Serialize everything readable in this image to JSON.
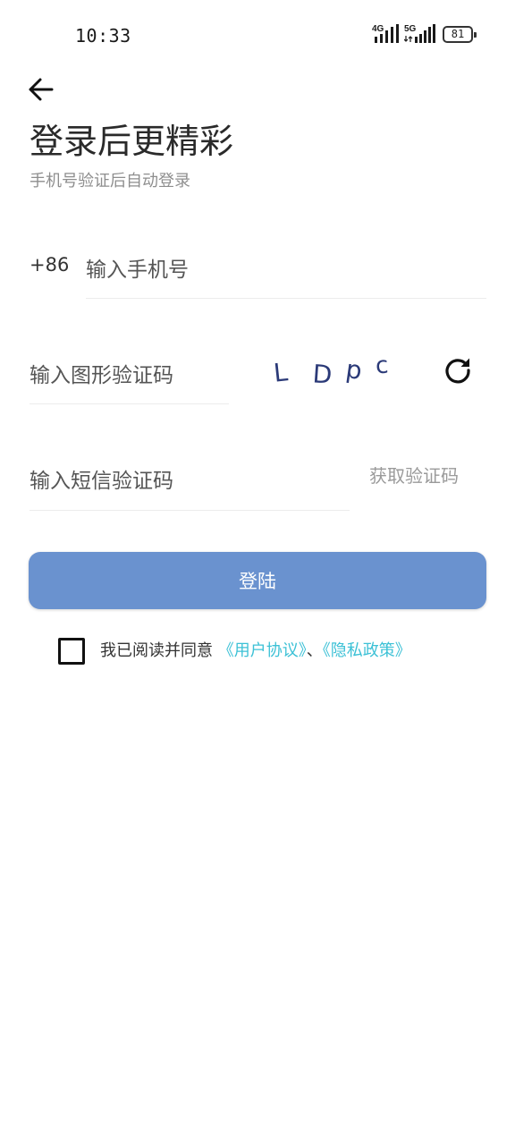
{
  "status_bar": {
    "time": "10:33",
    "network_1": "4G",
    "network_2": "5G",
    "battery_level": "81"
  },
  "header": {
    "back_icon": "arrow-left-icon",
    "title": "登录后更精彩",
    "subtitle": "手机号验证后自动登录"
  },
  "form": {
    "country_code": "+86",
    "phone_placeholder": "输入手机号",
    "captcha_placeholder": "输入图形验证码",
    "captcha_chars": [
      "L",
      "D",
      "p",
      "c"
    ],
    "refresh_icon": "refresh-icon",
    "sms_placeholder": "输入短信验证码",
    "get_code_label": "获取验证码",
    "login_label": "登陆"
  },
  "agreement": {
    "prefix": "我已阅读并同意",
    "user_agreement": "《用户协议》",
    "separator": "、",
    "privacy_policy": "《隐私政策》"
  },
  "colors": {
    "primary_button": "#6a92cf",
    "link": "#3cc1d6",
    "captcha_text": "#2b3a78"
  }
}
